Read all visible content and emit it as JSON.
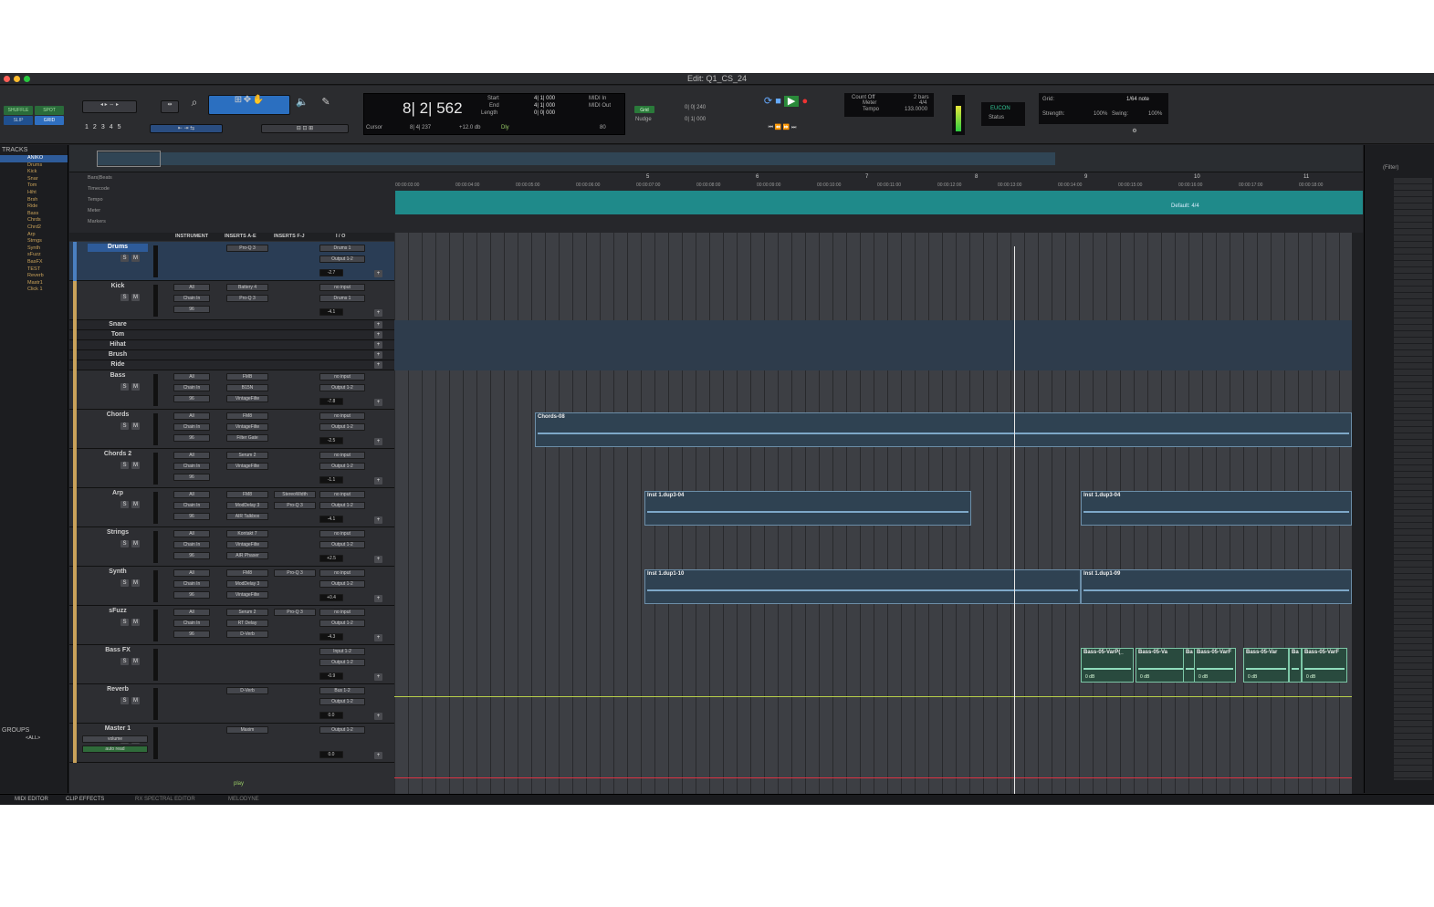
{
  "window": {
    "title": "Edit: Q1_CS_24"
  },
  "toolbar": {
    "modes": [
      "SHUFFLE",
      "SPOT",
      "SLIP",
      "GRID"
    ],
    "zoom_presets": [
      "1",
      "2",
      "3",
      "4",
      "5"
    ],
    "counter": {
      "main": "8| 2| 562",
      "start_label": "Start",
      "end_label": "End",
      "length_label": "Length",
      "start": "4| 1| 000",
      "end": "4| 1| 000",
      "length": "0| 0| 000",
      "cursor_label": "Cursor",
      "cursor_value": "8| 4| 237",
      "level": "+12.0 db",
      "dly_label": "Dly",
      "midi_in": "MIDI In",
      "midi_out": "MIDI Out",
      "value_80": "80"
    },
    "grid": {
      "label": "Grid",
      "value": "0| 0| 240",
      "nudge_label": "Nudge",
      "nudge_value": "0| 1| 000"
    },
    "count_off": {
      "count_off": "Count Off",
      "meter": "Meter",
      "tempo": "Tempo",
      "bars": "2 bars",
      "meter_value": "4/4",
      "tempo_value": "133.0000"
    },
    "eucon": {
      "label": "EUCON",
      "status": "Status"
    },
    "grid_settings": {
      "grid": "Grid:",
      "note": "1/64 note",
      "strength": "Strength:",
      "strength_val": "100%",
      "swing": "Swing:",
      "swing_val": "100%"
    }
  },
  "tracks_panel": {
    "header": "TRACKS",
    "items": [
      "ANIKO",
      "Drums",
      "Kick",
      "Snar",
      "Tom",
      "Hiht",
      "Brsh",
      "Ride",
      "Bass",
      "Chrds",
      "Chrd2",
      "Arp",
      "Strngs",
      "Synth",
      "sFuzz",
      "BasFX",
      "TEST",
      "Reverb",
      "Mastr1",
      "Click 1"
    ]
  },
  "groups_panel": {
    "header": "GROUPS",
    "all": "<ALL>"
  },
  "ruler": {
    "rows": [
      "Bars|Beats",
      "Timecode",
      "Tempo",
      "Meter",
      "Markers"
    ],
    "bars": [
      "5",
      "6",
      "7",
      "8",
      "9",
      "10",
      "11"
    ],
    "timecodes": [
      "00:00:03:00",
      "00:00:04:00",
      "00:00:05:00",
      "00:00:06:00",
      "00:00:07:00",
      "00:00:08:00",
      "00:00:09:00",
      "00:00:10:00",
      "00:00:11:00",
      "00:00:12:00",
      "00:00:13:00",
      "00:00:14:00",
      "00:00:15:00",
      "00:00:16:00",
      "00:00:17:00",
      "00:00:18:00"
    ],
    "meter_default": "Default: 4/4"
  },
  "columns": {
    "instrument": "INSTRUMENT",
    "inserts_ae": "INSERTS A-E",
    "inserts_fj": "INSERTS F-J",
    "io": "I / O"
  },
  "tracks": [
    {
      "name": "Drums",
      "inserts": [
        "Pro-Q 3"
      ],
      "io": [
        "Drums 1",
        "Output 1-2"
      ],
      "vol": "-2.7",
      "selected": true
    },
    {
      "name": "Kick",
      "inserts": [
        "Battery 4",
        "Pro-Q 3"
      ],
      "instr": [
        "All",
        "Chain In",
        "96"
      ],
      "io": [
        "no input",
        "Drums 1"
      ],
      "vol": "-4.1"
    },
    {
      "name": "Snare"
    },
    {
      "name": "Tom"
    },
    {
      "name": "Hihat"
    },
    {
      "name": "Brush"
    },
    {
      "name": "Ride"
    },
    {
      "name": "Bass",
      "inserts": [
        "FMB",
        "B15N",
        "VintageFilte"
      ],
      "instr": [
        "All",
        "Chain In",
        "96"
      ],
      "io": [
        "no input",
        "Output 1-2"
      ],
      "vol": "-7.8"
    },
    {
      "name": "Chords",
      "inserts": [
        "FM8",
        "VintageFilte",
        "Filter Gate"
      ],
      "instr": [
        "All",
        "Chain In",
        "96"
      ],
      "io": [
        "no input",
        "Output 1-2"
      ],
      "vol": "-2.5"
    },
    {
      "name": "Chords 2",
      "inserts": [
        "Serum 2",
        "VintageFilte"
      ],
      "instr": [
        "All",
        "Chain In",
        "96"
      ],
      "io": [
        "no input",
        "Output 1-2"
      ],
      "vol": "-1.1"
    },
    {
      "name": "Arp",
      "inserts": [
        "FM8",
        "ModDelay 3",
        "AIR Talkbox"
      ],
      "inserts2": [
        "StereoWidth",
        "Pro-Q 3"
      ],
      "instr": [
        "All",
        "Chain In",
        "96"
      ],
      "io": [
        "no input",
        "Output 1-2"
      ],
      "vol": "-4.1"
    },
    {
      "name": "Strings",
      "inserts": [
        "Kontakt 7",
        "VintageFilte",
        "AIR Phaser"
      ],
      "instr": [
        "All",
        "Chain In",
        "96"
      ],
      "io": [
        "no input",
        "Output 1-2"
      ],
      "vol": "+2.5"
    },
    {
      "name": "Synth",
      "inserts": [
        "FM8",
        "ModDelay 3",
        "VintageFilte"
      ],
      "inserts2": [
        "Pro-Q 3"
      ],
      "instr": [
        "All",
        "Chain In",
        "96"
      ],
      "io": [
        "no input",
        "Output 1-2"
      ],
      "vol": "+0.4"
    },
    {
      "name": "sFuzz",
      "inserts": [
        "Serum 2",
        "RT Delay",
        "D-Verb"
      ],
      "inserts2": [
        "Pro-Q 3"
      ],
      "instr": [
        "All",
        "Chain In",
        "96"
      ],
      "io": [
        "no input",
        "Output 1-2"
      ],
      "vol": "-4.3"
    },
    {
      "name": "Bass FX",
      "io": [
        "Input 1-2",
        "Output 1-2"
      ],
      "vol": "-0.9"
    },
    {
      "name": "Reverb",
      "inserts": [
        "D-Verb"
      ],
      "io": [
        "Bus 1-2",
        "Output 1-2"
      ],
      "vol": "0.0"
    },
    {
      "name": "Master 1",
      "inserts": [
        "Maxim"
      ],
      "io": [
        "Output 1-2"
      ],
      "vol": "0.0",
      "sub": [
        "volume",
        "auto read"
      ]
    }
  ],
  "clips": {
    "chords": "Chords-08",
    "arp1": "Inst 1.dup3-04",
    "arp2": "Inst 1.dup3-04",
    "synth1": "Inst 1.dup1-10",
    "synth2": "Inst 1.dup1-09",
    "bassfx": [
      "Bass-05-VarP(_",
      "Bass-05-Va",
      "Ba",
      "Bass-05-VarF",
      "Bass-05-Var",
      "Ba",
      "Bass-05-VarF"
    ],
    "clip_gain": "0 dB"
  },
  "play_label": "play",
  "right_panel": {
    "filter": "(Filter)"
  },
  "bottom_tabs": [
    "MIDI EDITOR",
    "CLIP EFFECTS",
    "RX SPECTRAL EDITOR",
    "MELODYNE"
  ],
  "colors": {
    "accent": "#2e5b99",
    "track_color": "#c9a25a",
    "clip_border": "#6c8ea8",
    "audio_clip": "#7cc6a6",
    "cursor": "#e8e8e8"
  }
}
